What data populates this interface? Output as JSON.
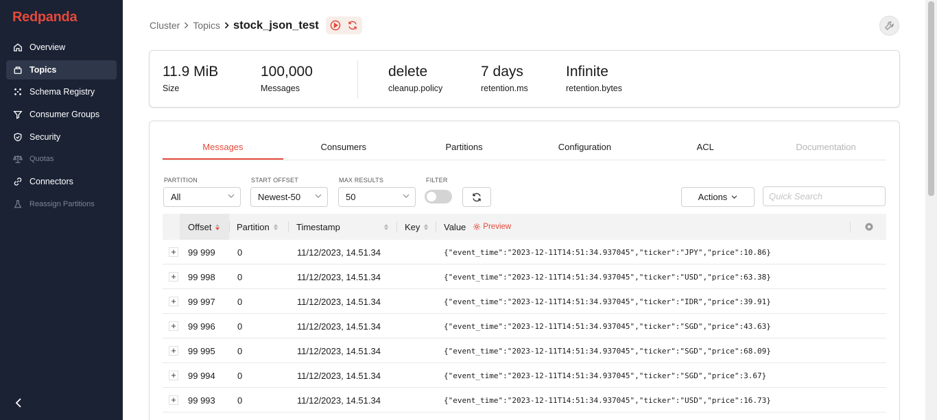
{
  "sidebar": {
    "logo": "Redpanda",
    "items": [
      {
        "label": "Overview",
        "icon": "home-icon"
      },
      {
        "label": "Topics",
        "icon": "topics-icon"
      },
      {
        "label": "Schema Registry",
        "icon": "schema-icon"
      },
      {
        "label": "Consumer Groups",
        "icon": "filter-icon"
      },
      {
        "label": "Security",
        "icon": "shield-icon"
      },
      {
        "label": "Quotas",
        "icon": "scale-icon"
      },
      {
        "label": "Connectors",
        "icon": "link-icon"
      },
      {
        "label": "Reassign Partitions",
        "icon": "beaker-icon"
      }
    ],
    "collapse_icon": "chevron-left-icon"
  },
  "header": {
    "breadcrumb": [
      "Cluster",
      "Topics"
    ],
    "title": "stock_json_test"
  },
  "stats": [
    {
      "value": "11.9 MiB",
      "label": "Size"
    },
    {
      "value": "100,000",
      "label": "Messages"
    },
    {
      "value": "delete",
      "label": "cleanup.policy"
    },
    {
      "value": "7 days",
      "label": "retention.ms"
    },
    {
      "value": "Infinite",
      "label": "retention.bytes"
    }
  ],
  "tabs": [
    {
      "label": "Messages",
      "state": "active"
    },
    {
      "label": "Consumers",
      "state": "normal"
    },
    {
      "label": "Partitions",
      "state": "normal"
    },
    {
      "label": "Configuration",
      "state": "normal"
    },
    {
      "label": "ACL",
      "state": "normal"
    },
    {
      "label": "Documentation",
      "state": "disabled"
    }
  ],
  "filters": {
    "partition": {
      "label": "PARTITION",
      "value": "All"
    },
    "start_offset": {
      "label": "START OFFSET",
      "value": "Newest-50"
    },
    "max_results": {
      "label": "MAX RESULTS",
      "value": "50"
    },
    "filter": {
      "label": "FILTER",
      "enabled": false
    },
    "actions_label": "Actions",
    "search_placeholder": "Quick Search"
  },
  "table": {
    "columns": [
      "Offset",
      "Partition",
      "Timestamp",
      "Key",
      "Value"
    ],
    "preview_label": "Preview",
    "rows": [
      {
        "offset": "99 999",
        "partition": "0",
        "timestamp": "11/12/2023, 14.51.34",
        "key": "",
        "value": "{\"event_time\":\"2023-12-11T14:51:34.937045\",\"ticker\":\"JPY\",\"price\":10.86}"
      },
      {
        "offset": "99 998",
        "partition": "0",
        "timestamp": "11/12/2023, 14.51.34",
        "key": "",
        "value": "{\"event_time\":\"2023-12-11T14:51:34.937045\",\"ticker\":\"USD\",\"price\":63.38}"
      },
      {
        "offset": "99 997",
        "partition": "0",
        "timestamp": "11/12/2023, 14.51.34",
        "key": "",
        "value": "{\"event_time\":\"2023-12-11T14:51:34.937045\",\"ticker\":\"IDR\",\"price\":39.91}"
      },
      {
        "offset": "99 996",
        "partition": "0",
        "timestamp": "11/12/2023, 14.51.34",
        "key": "",
        "value": "{\"event_time\":\"2023-12-11T14:51:34.937045\",\"ticker\":\"SGD\",\"price\":43.63}"
      },
      {
        "offset": "99 995",
        "partition": "0",
        "timestamp": "11/12/2023, 14.51.34",
        "key": "",
        "value": "{\"event_time\":\"2023-12-11T14:51:34.937045\",\"ticker\":\"SGD\",\"price\":68.09}"
      },
      {
        "offset": "99 994",
        "partition": "0",
        "timestamp": "11/12/2023, 14.51.34",
        "key": "",
        "value": "{\"event_time\":\"2023-12-11T14:51:34.937045\",\"ticker\":\"SGD\",\"price\":3.67}"
      },
      {
        "offset": "99 993",
        "partition": "0",
        "timestamp": "11/12/2023, 14.51.34",
        "key": "",
        "value": "{\"event_time\":\"2023-12-11T14:51:34.937045\",\"ticker\":\"USD\",\"price\":16.73}"
      }
    ]
  },
  "colors": {
    "accent": "#e5493a",
    "sidebar_bg": "#1a2234"
  }
}
